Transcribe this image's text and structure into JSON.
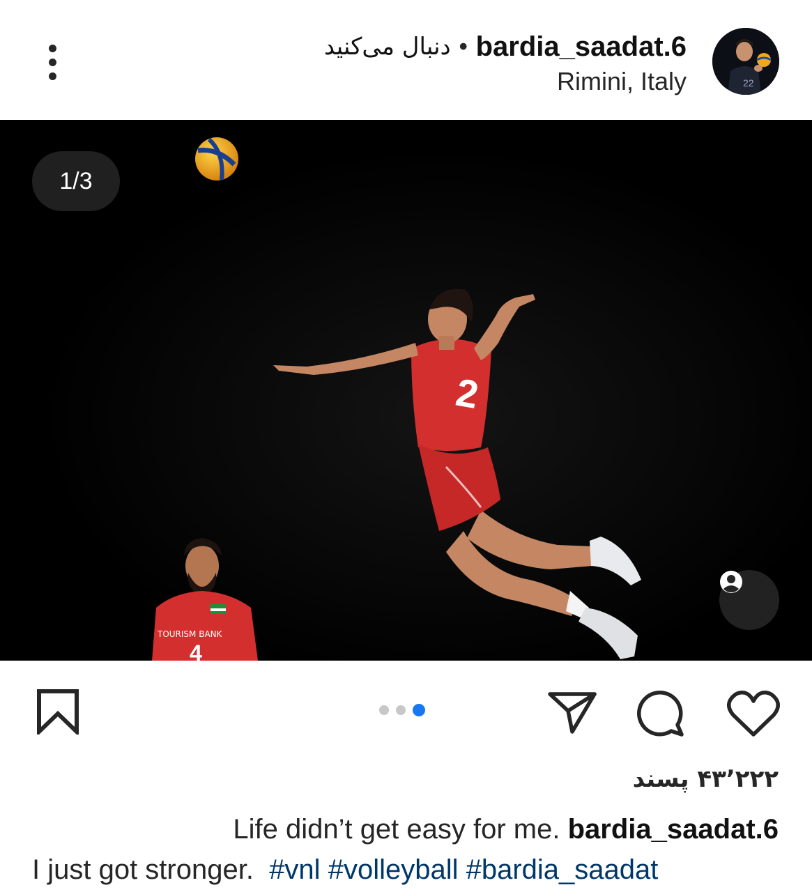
{
  "post": {
    "username": "bardia_saadat.6",
    "separator": "•",
    "follow_label": "دنبال می‌کنید",
    "location": "Rimini, Italy"
  },
  "media": {
    "counter": "1/3",
    "slide_count": 3,
    "active_slide": 3,
    "jersey_number": "2",
    "background_color": "#000000",
    "jersey_color": "#d32f2f"
  },
  "actions": {
    "save_icon": "bookmark-icon",
    "share_icon": "send-icon",
    "comment_icon": "comment-icon",
    "like_icon": "heart-icon"
  },
  "likes_text": "۴۳٬۲۲۲ پسند",
  "caption": {
    "username": "bardia_saadat.6",
    "line1_text": "Life didn’t get easy for me.",
    "line2_text": "I just got stronger.",
    "hashtags": [
      "#vnl",
      "#volleyball",
      "#bardia_saadat"
    ]
  },
  "colors": {
    "link": "#00376b",
    "dot_active": "#1877f2",
    "dot_inactive": "#c7c7c7"
  }
}
